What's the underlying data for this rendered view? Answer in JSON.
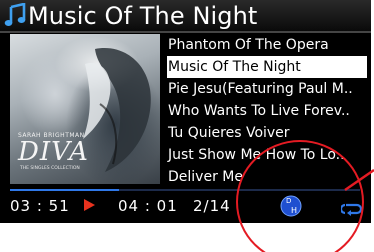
{
  "header": {
    "title": "Music Of The Night",
    "icon": "music-note-icon"
  },
  "album": {
    "artist": "SARAH BRIGHTMAN",
    "title": "DIVA",
    "subtitle": "THE SINGLES COLLECTION"
  },
  "tracks": [
    {
      "label": "Phantom Of The Opera",
      "selected": false
    },
    {
      "label": "Music Of The Night",
      "selected": true
    },
    {
      "label": "Pie Jesu(Featuring Paul M..",
      "selected": false
    },
    {
      "label": "Who Wants To Live Forev..",
      "selected": false
    },
    {
      "label": "Tu Quieres Voiver",
      "selected": false
    },
    {
      "label": "Just Show Me How To Lo..",
      "selected": false
    },
    {
      "label": "Deliver Me",
      "selected": false
    }
  ],
  "playback": {
    "elapsed": "03 : 51",
    "total": "04 : 01",
    "counter": "2/14",
    "progress_fraction": 0.31,
    "state": "playing"
  },
  "icons": {
    "play": "play-icon",
    "dh": "dh-icon",
    "repeat": "repeat-icon"
  },
  "colors": {
    "accent_blue": "#2f78e8",
    "play_red": "#e8321e",
    "annotation_red": "#e41b23",
    "background": "#000000",
    "selected_bg": "#ffffff"
  }
}
